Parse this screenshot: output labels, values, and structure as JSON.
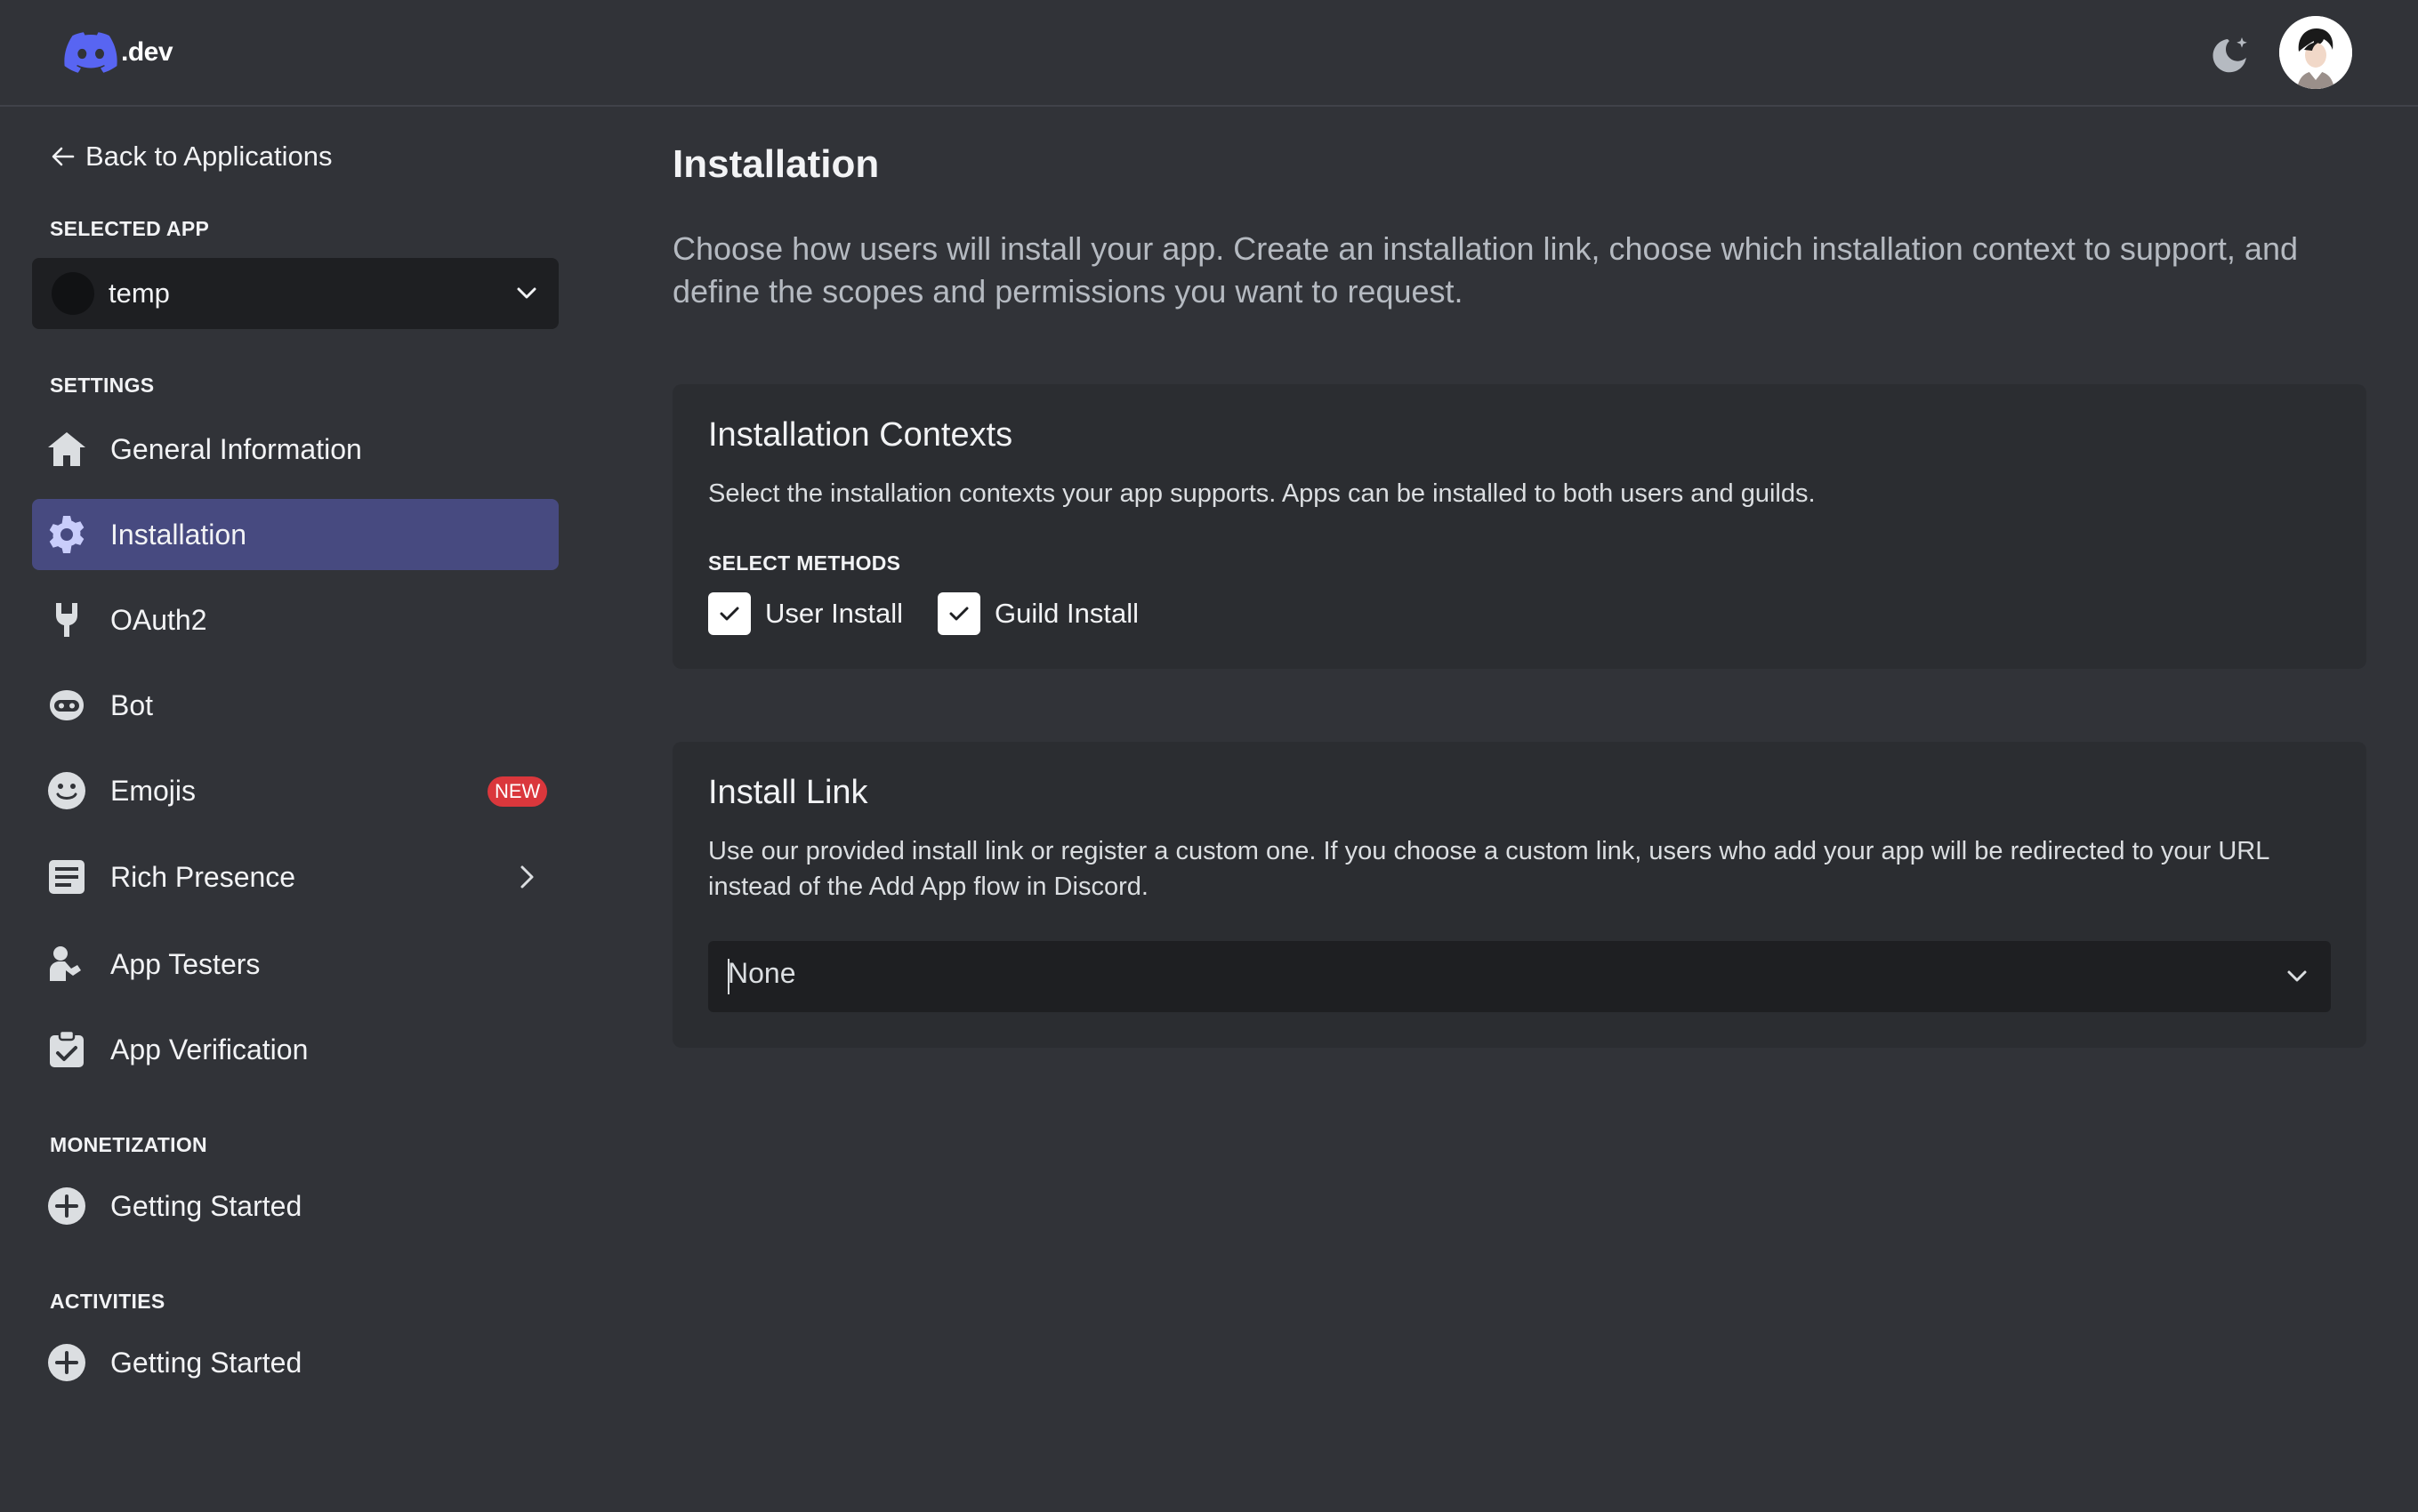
{
  "header": {
    "logo_text": ".dev",
    "theme_icon": "moon-icon",
    "avatar_icon": "avatar"
  },
  "sidebar": {
    "back_label": "Back to Applications",
    "selected_app_heading": "SELECTED APP",
    "selected_app_name": "temp",
    "settings_heading": "SETTINGS",
    "settings_items": [
      {
        "label": "General Information",
        "icon": "home-icon"
      },
      {
        "label": "Installation",
        "icon": "gear-icon",
        "active": true
      },
      {
        "label": "OAuth2",
        "icon": "wrench-icon"
      },
      {
        "label": "Bot",
        "icon": "bot-icon"
      },
      {
        "label": "Emojis",
        "icon": "emoji-icon",
        "badge": "NEW"
      },
      {
        "label": "Rich Presence",
        "icon": "document-icon"
      },
      {
        "label": "App Testers",
        "icon": "tester-icon"
      },
      {
        "label": "App Verification",
        "icon": "clipboard-check-icon"
      }
    ],
    "monetization_heading": "MONETIZATION",
    "monetization_items": [
      {
        "label": "Getting Started",
        "icon": "plus-circle-icon"
      }
    ],
    "activities_heading": "ACTIVITIES",
    "activities_items": [
      {
        "label": "Getting Started",
        "icon": "plus-circle-icon"
      }
    ]
  },
  "main": {
    "title": "Installation",
    "description": "Choose how users will install your app. Create an installation link, choose which installation context to support, and define the scopes and permissions you want to request.",
    "contexts_card": {
      "title": "Installation Contexts",
      "description": "Select the installation contexts your app supports. Apps can be installed to both users and guilds.",
      "methods_label": "SELECT METHODS",
      "options": [
        {
          "label": "User Install",
          "checked": true
        },
        {
          "label": "Guild Install",
          "checked": true
        }
      ]
    },
    "link_card": {
      "title": "Install Link",
      "description": "Use our provided install link or register a custom one. If you choose a custom link, users who add your app will be redirected to your URL instead of the Add App flow in Discord.",
      "selected_value": "None"
    }
  },
  "colors": {
    "background": "#313338",
    "sidebar_active": "#474a80",
    "brand": "#5865f2",
    "card": "#2b2d31",
    "input": "#1e1f22",
    "badge": "#da373c"
  }
}
